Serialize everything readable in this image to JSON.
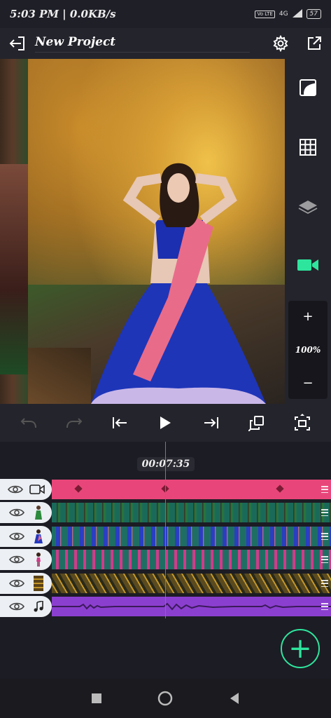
{
  "status_bar": {
    "time_and_speed": "5:03 PM | 0.0KB/s",
    "volte_label": "Vo LTE",
    "network_label": "4G",
    "battery_level": "57"
  },
  "top_bar": {
    "title": "New Project"
  },
  "right_toolbar": {
    "zoom_in_label": "+",
    "zoom_level": "100%",
    "zoom_out_label": "−"
  },
  "timeline": {
    "timecode": "00:07:35",
    "tracks": [
      {
        "type": "video",
        "icon": "video-camera-icon",
        "color": "#e8467a"
      },
      {
        "type": "image",
        "icon": "woman-green-thumbnail-icon",
        "color": "#1e6b5c"
      },
      {
        "type": "image",
        "icon": "woman-blue-thumbnail-icon",
        "color": "#1f6e63"
      },
      {
        "type": "image",
        "icon": "woman-pink-thumbnail-icon",
        "color": "#1f6e63"
      },
      {
        "type": "image",
        "icon": "texture-thumbnail-icon",
        "color": "#5a4a1e"
      },
      {
        "type": "audio",
        "icon": "music-note-icon",
        "color": "#8b3fcf"
      }
    ]
  },
  "colors": {
    "accent_green": "#2ee59d",
    "playhead": "#ff3b5c",
    "background": "#1c1c24"
  },
  "fab": {
    "label": "+"
  }
}
